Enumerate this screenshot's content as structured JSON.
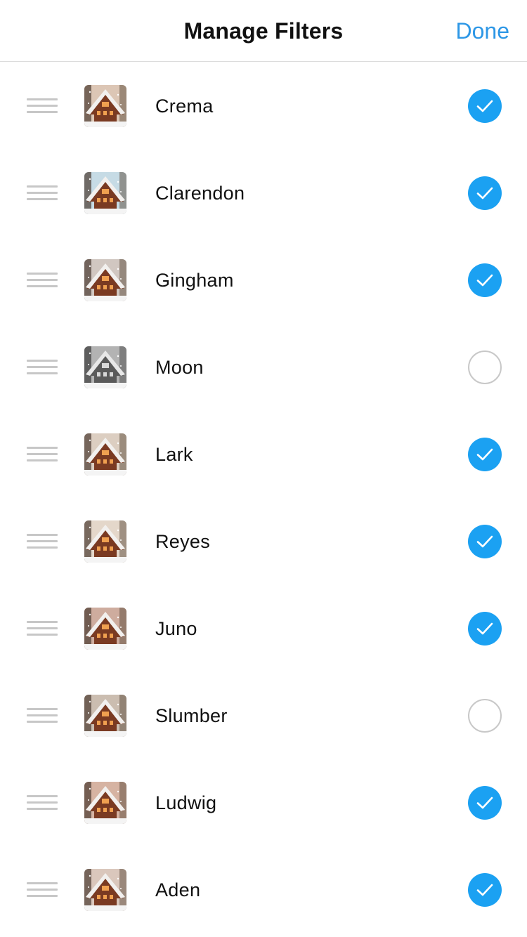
{
  "nav": {
    "title": "Manage Filters",
    "done_label": "Done"
  },
  "colors": {
    "accent": "#1ba1f2",
    "done_text": "#2d97e6",
    "handle": "#c7c7c7"
  },
  "filters": [
    {
      "name": "Crema",
      "enabled": true,
      "tint": "#c9a88e"
    },
    {
      "name": "Clarendon",
      "enabled": true,
      "tint": "#a8c8d8"
    },
    {
      "name": "Gingham",
      "enabled": true,
      "tint": "#b8aaa0"
    },
    {
      "name": "Moon",
      "enabled": false,
      "tint": "#8a8a8a"
    },
    {
      "name": "Lark",
      "enabled": true,
      "tint": "#c9b4a0"
    },
    {
      "name": "Reyes",
      "enabled": true,
      "tint": "#d6c2ae"
    },
    {
      "name": "Juno",
      "enabled": true,
      "tint": "#b4806a"
    },
    {
      "name": "Slumber",
      "enabled": false,
      "tint": "#b09a86"
    },
    {
      "name": "Ludwig",
      "enabled": true,
      "tint": "#c08a70"
    },
    {
      "name": "Aden",
      "enabled": true,
      "tint": "#c6aa98"
    }
  ]
}
